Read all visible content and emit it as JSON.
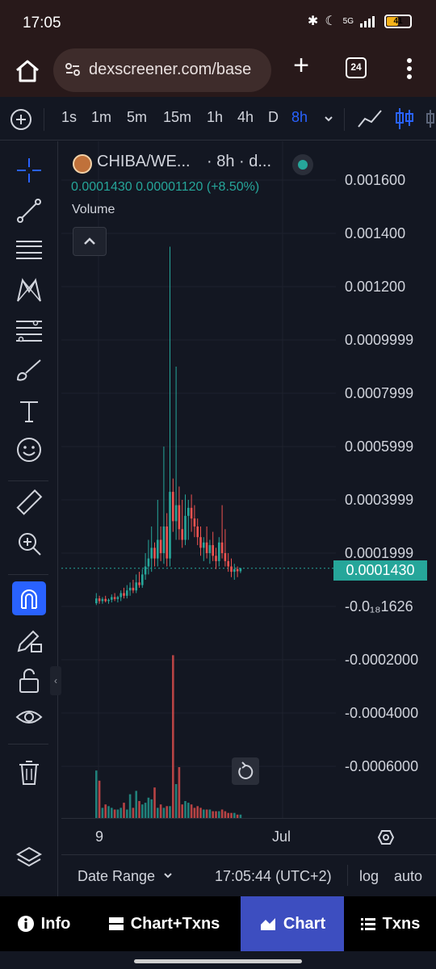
{
  "status_bar": {
    "time": "17:05",
    "network": "5G",
    "battery": "41"
  },
  "browser": {
    "url": "dexscreener.com/base",
    "tab_count": "24"
  },
  "timeframes": {
    "items": [
      "1s",
      "1m",
      "5m",
      "15m",
      "1h",
      "4h",
      "D",
      "8h"
    ],
    "active": "8h"
  },
  "legend": {
    "pair": "CHIBA/WE...",
    "interval": "· 8h · d...",
    "values": "0.0001430  0.00001120 (+8.50%)",
    "volume_label": "Volume"
  },
  "price_axis": {
    "labels": [
      "0.001600",
      "0.001400",
      "0.001200",
      "0.0009999",
      "0.0007999",
      "0.0005999",
      "0.0003999",
      "0.0001999",
      "-0.0₁₈1626",
      "-0.0002000",
      "-0.0004000",
      "-0.0006000"
    ],
    "last_price": "0.0001430"
  },
  "time_axis": {
    "labels": [
      "9",
      "Jul"
    ]
  },
  "bottom_bar": {
    "date_range": "Date Range",
    "clock": "17:05:44 (UTC+2)",
    "log": "log",
    "auto": "auto"
  },
  "tabs": [
    {
      "label": "Info",
      "icon": "info-icon"
    },
    {
      "label": "Chart+Txns",
      "icon": "chart-txns-icon"
    },
    {
      "label": "Chart",
      "icon": "chart-icon",
      "active": true
    },
    {
      "label": "Txns",
      "icon": "list-icon"
    }
  ],
  "colors": {
    "up": "#26a69a",
    "down": "#ef5350",
    "accent": "#2962ff",
    "tab_active": "#3d4ec0"
  },
  "chart_data": {
    "type": "candlestick",
    "series_note": "8h candles with volume histogram",
    "candles": [
      {
        "o": 1.2e-05,
        "h": 5e-05,
        "l": 5e-06,
        "c": 3e-05
      },
      {
        "o": 3e-05,
        "h": 4e-05,
        "l": 1e-05,
        "c": 2e-05
      },
      {
        "o": 2e-05,
        "h": 3.5e-05,
        "l": 1e-05,
        "c": 2.8e-05
      },
      {
        "o": 2.8e-05,
        "h": 4e-05,
        "l": 1.5e-05,
        "c": 2e-05
      },
      {
        "o": 2e-05,
        "h": 3e-05,
        "l": 1e-05,
        "c": 2.5e-05
      },
      {
        "o": 2.5e-05,
        "h": 4.5e-05,
        "l": 1.5e-05,
        "c": 3.5e-05
      },
      {
        "o": 3.5e-05,
        "h": 5e-05,
        "l": 2e-05,
        "c": 2.8e-05
      },
      {
        "o": 2.8e-05,
        "h": 4e-05,
        "l": 1.5e-05,
        "c": 3.5e-05
      },
      {
        "o": 3.5e-05,
        "h": 6e-05,
        "l": 2e-05,
        "c": 5e-05
      },
      {
        "o": 5e-05,
        "h": 7e-05,
        "l": 3e-05,
        "c": 4e-05
      },
      {
        "o": 4e-05,
        "h": 8e-05,
        "l": 3e-05,
        "c": 6e-05
      },
      {
        "o": 6e-05,
        "h": 9e-05,
        "l": 4e-05,
        "c": 7e-05
      },
      {
        "o": 7e-05,
        "h": 0.0001,
        "l": 5e-05,
        "c": 6e-05
      },
      {
        "o": 6e-05,
        "h": 0.00012,
        "l": 5e-05,
        "c": 9e-05
      },
      {
        "o": 9e-05,
        "h": 0.00013,
        "l": 7e-05,
        "c": 8e-05
      },
      {
        "o": 8e-05,
        "h": 0.00014,
        "l": 7e-05,
        "c": 0.00012
      },
      {
        "o": 0.00012,
        "h": 0.0002,
        "l": 0.0001,
        "c": 0.00015
      },
      {
        "o": 0.00015,
        "h": 0.00025,
        "l": 0.00012,
        "c": 0.00018
      },
      {
        "o": 0.00018,
        "h": 0.0003,
        "l": 0.00013,
        "c": 0.00022
      },
      {
        "o": 0.00022,
        "h": 0.00024,
        "l": 0.00015,
        "c": 0.00018
      },
      {
        "o": 0.00018,
        "h": 0.0004,
        "l": 0.00015,
        "c": 0.00025
      },
      {
        "o": 0.00025,
        "h": 0.0003,
        "l": 0.00017,
        "c": 0.0002
      },
      {
        "o": 0.0002,
        "h": 0.0006,
        "l": 0.00016,
        "c": 0.0003
      },
      {
        "o": 0.0003,
        "h": 0.00035,
        "l": 0.00015,
        "c": 0.00018
      },
      {
        "o": 0.00018,
        "h": 0.00135,
        "l": 0.00015,
        "c": 0.00043
      },
      {
        "o": 0.00043,
        "h": 0.00048,
        "l": 0.00028,
        "c": 0.00032
      },
      {
        "o": 0.00032,
        "h": 0.0009,
        "l": 0.00025,
        "c": 0.00038
      },
      {
        "o": 0.00038,
        "h": 0.00045,
        "l": 0.00025,
        "c": 0.00029
      },
      {
        "o": 0.00029,
        "h": 0.0004,
        "l": 0.00022,
        "c": 0.00025
      },
      {
        "o": 0.00025,
        "h": 0.00042,
        "l": 0.00023,
        "c": 0.00034
      },
      {
        "o": 0.00034,
        "h": 0.0004,
        "l": 0.00025,
        "c": 0.00037
      },
      {
        "o": 0.00037,
        "h": 0.00042,
        "l": 0.00028,
        "c": 0.00033
      },
      {
        "o": 0.00033,
        "h": 0.00038,
        "l": 0.00026,
        "c": 0.0003
      },
      {
        "o": 0.0003,
        "h": 0.00033,
        "l": 0.00023,
        "c": 0.00026
      },
      {
        "o": 0.00026,
        "h": 0.0003,
        "l": 0.00019,
        "c": 0.00022
      },
      {
        "o": 0.00022,
        "h": 0.00026,
        "l": 0.00017,
        "c": 0.00024
      },
      {
        "o": 0.00024,
        "h": 0.0003,
        "l": 0.00018,
        "c": 0.0002
      },
      {
        "o": 0.0002,
        "h": 0.00025,
        "l": 0.00016,
        "c": 0.00023
      },
      {
        "o": 0.00023,
        "h": 0.00028,
        "l": 0.00017,
        "c": 0.00019
      },
      {
        "o": 0.00019,
        "h": 0.00022,
        "l": 0.00014,
        "c": 0.00017
      },
      {
        "o": 0.00017,
        "h": 0.00026,
        "l": 0.00015,
        "c": 0.00024
      },
      {
        "o": 0.00024,
        "h": 0.00038,
        "l": 0.00018,
        "c": 0.0002
      },
      {
        "o": 0.0002,
        "h": 0.00029,
        "l": 0.00015,
        "c": 0.00017
      },
      {
        "o": 0.00017,
        "h": 0.0002,
        "l": 0.00013,
        "c": 0.00015
      },
      {
        "o": 0.00015,
        "h": 0.00018,
        "l": 0.00011,
        "c": 0.00013
      },
      {
        "o": 0.00013,
        "h": 0.00016,
        "l": 0.0001,
        "c": 0.00014
      },
      {
        "o": 0.00014,
        "h": 0.00015,
        "l": 0.00011,
        "c": 0.000132
      },
      {
        "o": 0.000132,
        "h": 0.000145,
        "l": 0.000125,
        "c": 0.000143
      }
    ],
    "volume": [
      0.28,
      0.22,
      0.06,
      0.08,
      0.07,
      0.06,
      0.05,
      0.05,
      0.06,
      0.09,
      0.05,
      0.14,
      0.06,
      0.16,
      0.1,
      0.08,
      0.09,
      0.12,
      0.11,
      0.18,
      0.06,
      0.08,
      0.06,
      0.07,
      0.07,
      0.96,
      0.2,
      0.3,
      0.08,
      0.1,
      0.09,
      0.08,
      0.06,
      0.07,
      0.06,
      0.05,
      0.05,
      0.05,
      0.04,
      0.04,
      0.04,
      0.05,
      0.04,
      0.03,
      0.03,
      0.03,
      0.02,
      0.02
    ],
    "ylim": [
      -0.0006,
      0.0017
    ],
    "x_ticks": [
      "9",
      "Jul"
    ]
  }
}
